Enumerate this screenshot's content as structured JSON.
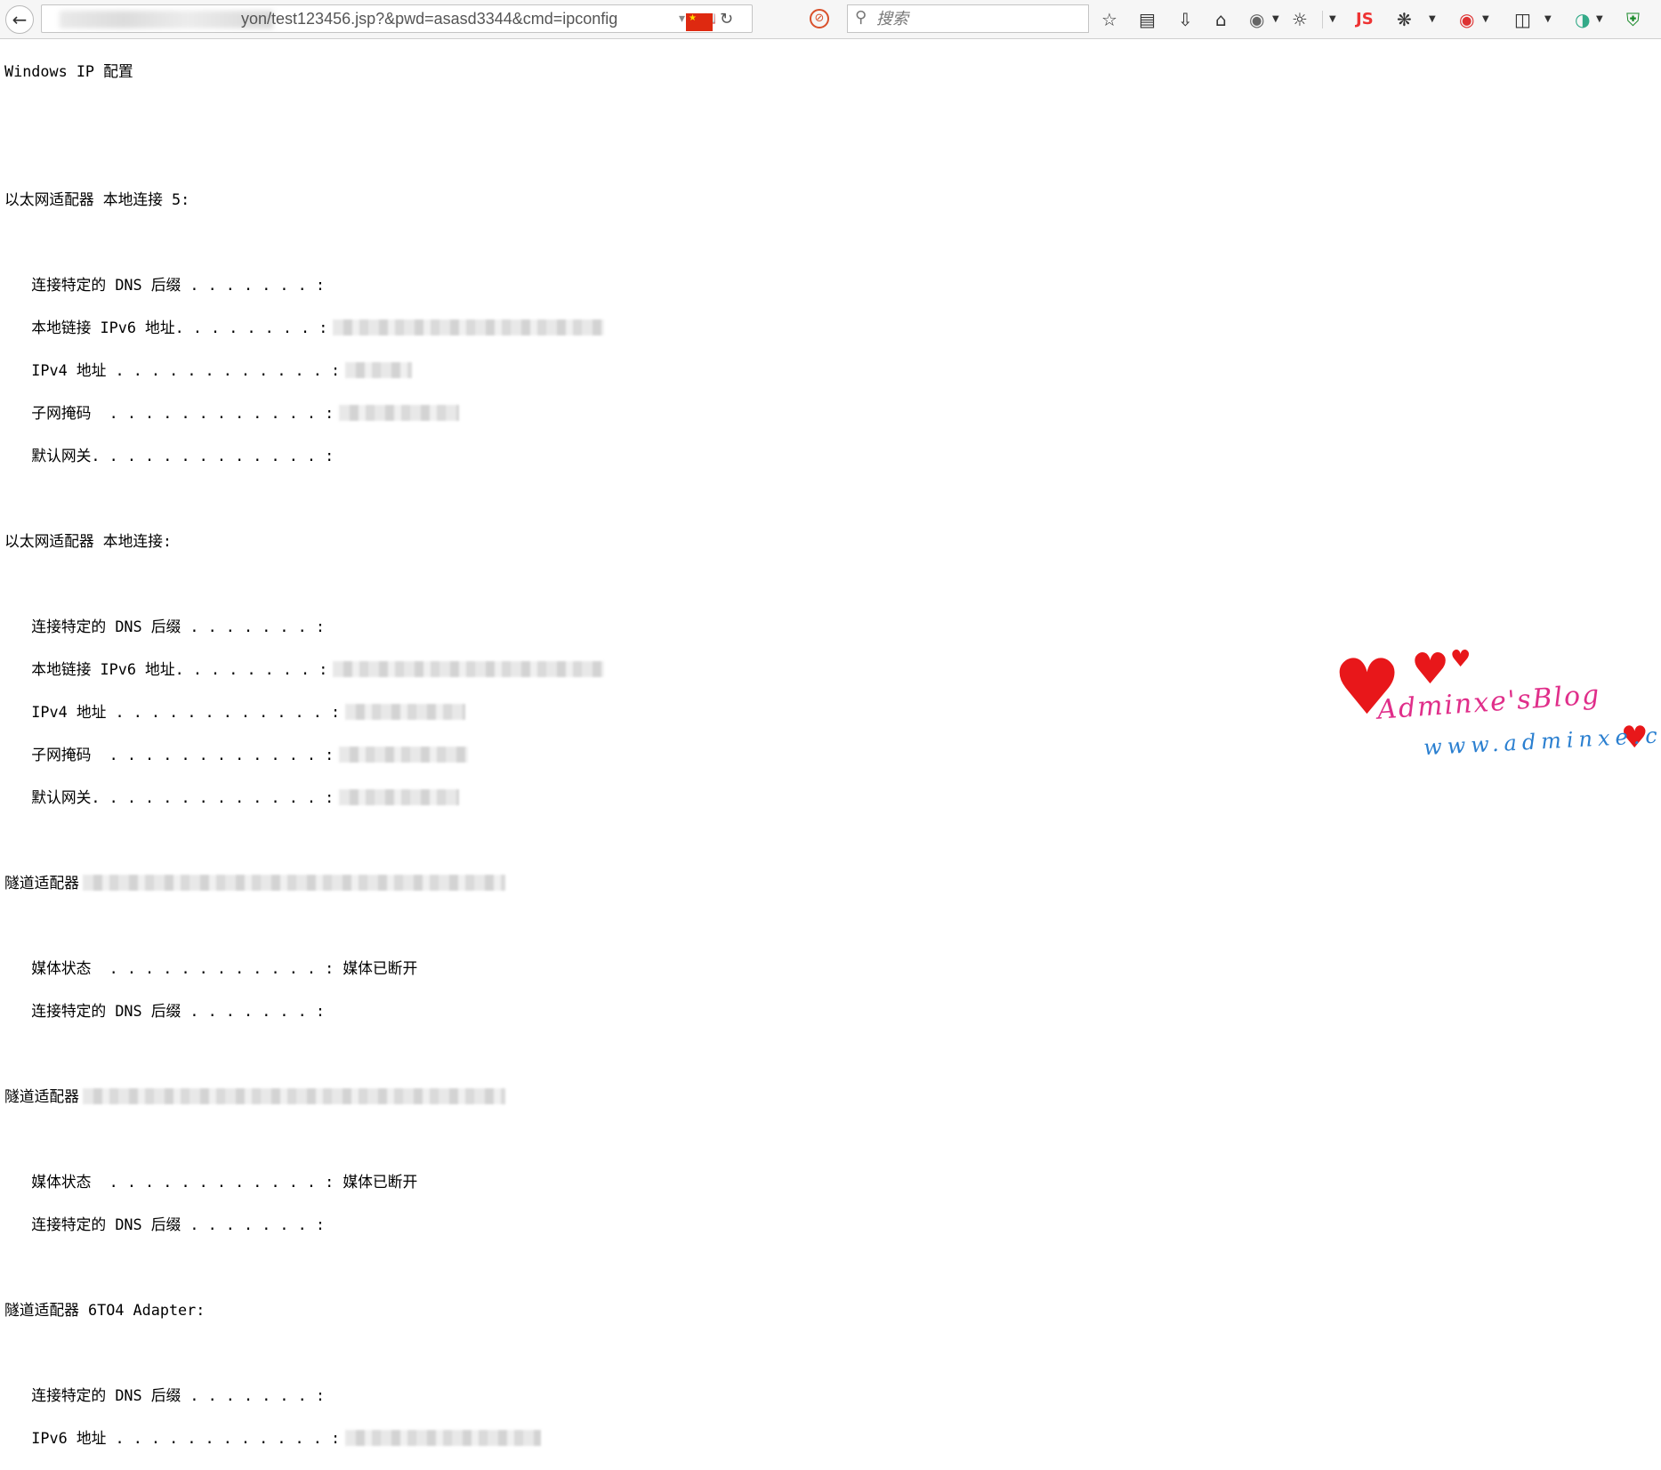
{
  "browser": {
    "url_visible": "yon/test123456.jsp?&pwd=asasd3344&cmd=ipconfig",
    "search_placeholder": "搜索",
    "js_label": "JS",
    "icons": [
      "back-icon",
      "reader-view-icon",
      "flag-cn-icon",
      "reload-icon",
      "no-script-icon",
      "search-icon",
      "bookmark-star-icon",
      "clipboard-icon",
      "download-icon",
      "home-icon",
      "globe-icon",
      "palette-icon",
      "firebug-icon",
      "red-addon-icon",
      "shield-icon"
    ]
  },
  "console": {
    "lines": [
      "Windows IP 配置",
      "",
      "",
      "以太网适配器 本地连接 5:",
      "",
      "   连接特定的 DNS 后缀 . . . . . . . :",
      "   本地链接 IPv6 地址. . . . . . . . :",
      "   IPv4 地址 . . . . . . . . . . . . :",
      "   子网掩码  . . . . . . . . . . . . :",
      "   默认网关. . . . . . . . . . . . . :",
      "",
      "以太网适配器 本地连接:",
      "",
      "   连接特定的 DNS 后缀 . . . . . . . :",
      "   本地链接 IPv6 地址. . . . . . . . :",
      "   IPv4 地址 . . . . . . . . . . . . :",
      "   子网掩码  . . . . . . . . . . . . :",
      "   默认网关. . . . . . . . . . . . . :",
      "",
      "隧道适配器",
      "",
      "   媒体状态  . . . . . . . . . . . . : 媒体已断开",
      "   连接特定的 DNS 后缀 . . . . . . . :",
      "",
      "隧道适配器",
      "",
      "   媒体状态  . . . . . . . . . . . . : 媒体已断开",
      "   连接特定的 DNS 后缀 . . . . . . . :",
      "",
      "隧道适配器 6TO4 Adapter:",
      "",
      "   连接特定的 DNS 后缀 . . . . . . . :",
      "   IPv6 地址 . . . . . . . . . . . . :"
    ]
  },
  "watermark": {
    "title": "Adminxe'sBlog",
    "url": "www.adminxe.com"
  }
}
